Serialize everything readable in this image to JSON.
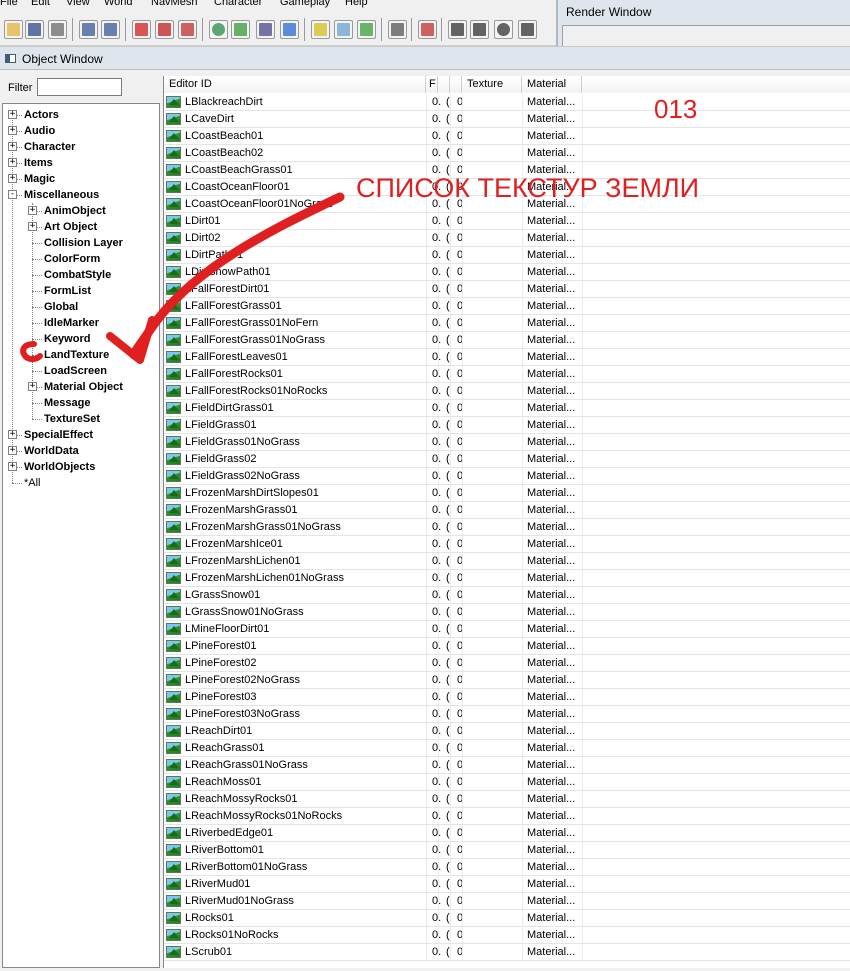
{
  "menu": [
    "File",
    "Edit",
    "View",
    "World",
    "NavMesh",
    "Character",
    "Gameplay",
    "Help"
  ],
  "toolbar_icons": [
    "open-icon",
    "save-icon",
    "preferences-icon",
    "undo-icon",
    "redo-icon",
    "render-region-icon",
    "marker-icon",
    "navmesh-icon",
    "world-icon",
    "landscape-icon",
    "havok-icon",
    "reference-icon",
    "light-bulb-icon",
    "sky-icon",
    "grass-icon",
    "speech-bubble-icon",
    "animation-icon",
    "box-icon",
    "box-m-icon",
    "box-o-icon",
    "box-d-icon",
    "box-c-icon"
  ],
  "render_window": {
    "title": "Render Window"
  },
  "object_window": {
    "title": "Object Window",
    "filter_label": "Filter",
    "filter_value": ""
  },
  "tree": [
    {
      "label": "Actors",
      "depth": 0,
      "expander": "+"
    },
    {
      "label": "Audio",
      "depth": 0,
      "expander": "+"
    },
    {
      "label": "Character",
      "depth": 0,
      "expander": "+"
    },
    {
      "label": "Items",
      "depth": 0,
      "expander": "+"
    },
    {
      "label": "Magic",
      "depth": 0,
      "expander": "+"
    },
    {
      "label": "Miscellaneous",
      "depth": 0,
      "expander": "-"
    },
    {
      "label": "AnimObject",
      "depth": 1,
      "expander": "+"
    },
    {
      "label": "Art Object",
      "depth": 1,
      "expander": "+"
    },
    {
      "label": "Collision Layer",
      "depth": 1,
      "expander": ""
    },
    {
      "label": "ColorForm",
      "depth": 1,
      "expander": ""
    },
    {
      "label": "CombatStyle",
      "depth": 1,
      "expander": ""
    },
    {
      "label": "FormList",
      "depth": 1,
      "expander": ""
    },
    {
      "label": "Global",
      "depth": 1,
      "expander": ""
    },
    {
      "label": "IdleMarker",
      "depth": 1,
      "expander": ""
    },
    {
      "label": "Keyword",
      "depth": 1,
      "expander": ""
    },
    {
      "label": "LandTexture",
      "depth": 1,
      "expander": ""
    },
    {
      "label": "LoadScreen",
      "depth": 1,
      "expander": ""
    },
    {
      "label": "Material Object",
      "depth": 1,
      "expander": "+"
    },
    {
      "label": "Message",
      "depth": 1,
      "expander": ""
    },
    {
      "label": "TextureSet",
      "depth": 1,
      "expander": ""
    },
    {
      "label": "SpecialEffect",
      "depth": 0,
      "expander": "+"
    },
    {
      "label": "WorldData",
      "depth": 0,
      "expander": "+"
    },
    {
      "label": "WorldObjects",
      "depth": 0,
      "expander": "+"
    },
    {
      "label": "*All",
      "depth": 0,
      "expander": "",
      "plain": true
    }
  ],
  "columns": [
    "Editor ID",
    "F",
    "",
    "",
    "Texture",
    "Material"
  ],
  "rows": [
    {
      "id": "LBlackreachDirt",
      "f": "0.",
      "a": "(",
      "b": "0",
      "mat": "Material..."
    },
    {
      "id": "LCaveDirt",
      "f": "0.",
      "a": "(",
      "b": "0",
      "mat": "Material..."
    },
    {
      "id": "LCoastBeach01",
      "f": "0.",
      "a": "(",
      "b": "0",
      "mat": "Material..."
    },
    {
      "id": "LCoastBeach02",
      "f": "0.",
      "a": "(",
      "b": "0",
      "mat": "Material..."
    },
    {
      "id": "LCoastBeachGrass01",
      "f": "0.",
      "a": "(",
      "b": "0",
      "mat": "Material..."
    },
    {
      "id": "LCoastOceanFloor01",
      "f": "0.",
      "a": "(",
      "b": "0",
      "mat": "Material..."
    },
    {
      "id": "LCoastOceanFloor01NoGrass",
      "f": "0.",
      "a": "(",
      "b": "0",
      "mat": "Material..."
    },
    {
      "id": "LDirt01",
      "f": "0.",
      "a": "(",
      "b": "0",
      "mat": "Material..."
    },
    {
      "id": "LDirt02",
      "f": "0.",
      "a": "(",
      "b": "0",
      "mat": "Material..."
    },
    {
      "id": "LDirtPath01",
      "f": "0.",
      "a": "(",
      "b": "0",
      "mat": "Material..."
    },
    {
      "id": "LDirtSnowPath01",
      "f": "0.",
      "a": "(",
      "b": "0",
      "mat": "Material..."
    },
    {
      "id": "LFallForestDirt01",
      "f": "0.",
      "a": "(",
      "b": "0",
      "mat": "Material..."
    },
    {
      "id": "LFallForestGrass01",
      "f": "0.",
      "a": "(",
      "b": "0",
      "mat": "Material..."
    },
    {
      "id": "LFallForestGrass01NoFern",
      "f": "0.",
      "a": "(",
      "b": "0",
      "mat": "Material..."
    },
    {
      "id": "LFallForestGrass01NoGrass",
      "f": "0.",
      "a": "(",
      "b": "0",
      "mat": "Material..."
    },
    {
      "id": "LFallForestLeaves01",
      "f": "0.",
      "a": "(",
      "b": "0",
      "mat": "Material..."
    },
    {
      "id": "LFallForestRocks01",
      "f": "0.",
      "a": "(",
      "b": "0",
      "mat": "Material..."
    },
    {
      "id": "LFallForestRocks01NoRocks",
      "f": "0.",
      "a": "(",
      "b": "0",
      "mat": "Material..."
    },
    {
      "id": "LFieldDirtGrass01",
      "f": "0.",
      "a": "(",
      "b": "0",
      "mat": "Material..."
    },
    {
      "id": "LFieldGrass01",
      "f": "0.",
      "a": "(",
      "b": "0",
      "mat": "Material..."
    },
    {
      "id": "LFieldGrass01NoGrass",
      "f": "0.",
      "a": "(",
      "b": "0",
      "mat": "Material..."
    },
    {
      "id": "LFieldGrass02",
      "f": "0.",
      "a": "(",
      "b": "0",
      "mat": "Material..."
    },
    {
      "id": "LFieldGrass02NoGrass",
      "f": "0.",
      "a": "(",
      "b": "0",
      "mat": "Material..."
    },
    {
      "id": "LFrozenMarshDirtSlopes01",
      "f": "0.",
      "a": "(",
      "b": "0",
      "mat": "Material..."
    },
    {
      "id": "LFrozenMarshGrass01",
      "f": "0.",
      "a": "(",
      "b": "0",
      "mat": "Material..."
    },
    {
      "id": "LFrozenMarshGrass01NoGrass",
      "f": "0.",
      "a": "(",
      "b": "0",
      "mat": "Material..."
    },
    {
      "id": "LFrozenMarshIce01",
      "f": "0.",
      "a": "(",
      "b": "0",
      "mat": "Material..."
    },
    {
      "id": "LFrozenMarshLichen01",
      "f": "0.",
      "a": "(",
      "b": "0",
      "mat": "Material..."
    },
    {
      "id": "LFrozenMarshLichen01NoGrass",
      "f": "0.",
      "a": "(",
      "b": "0",
      "mat": "Material..."
    },
    {
      "id": "LGrassSnow01",
      "f": "0.",
      "a": "(",
      "b": "0",
      "mat": "Material..."
    },
    {
      "id": "LGrassSnow01NoGrass",
      "f": "0.",
      "a": "(",
      "b": "0",
      "mat": "Material..."
    },
    {
      "id": "LMineFloorDirt01",
      "f": "0.",
      "a": "(",
      "b": "0",
      "mat": "Material..."
    },
    {
      "id": "LPineForest01",
      "f": "0.",
      "a": "(",
      "b": "0",
      "mat": "Material..."
    },
    {
      "id": "LPineForest02",
      "f": "0.",
      "a": "(",
      "b": "0",
      "mat": "Material..."
    },
    {
      "id": "LPineForest02NoGrass",
      "f": "0.",
      "a": "(",
      "b": "0",
      "mat": "Material..."
    },
    {
      "id": "LPineForest03",
      "f": "0.",
      "a": "(",
      "b": "0",
      "mat": "Material..."
    },
    {
      "id": "LPineForest03NoGrass",
      "f": "0.",
      "a": "(",
      "b": "0",
      "mat": "Material..."
    },
    {
      "id": "LReachDirt01",
      "f": "0.",
      "a": "(",
      "b": "0",
      "mat": "Material..."
    },
    {
      "id": "LReachGrass01",
      "f": "0.",
      "a": "(",
      "b": "0",
      "mat": "Material..."
    },
    {
      "id": "LReachGrass01NoGrass",
      "f": "0.",
      "a": "(",
      "b": "0",
      "mat": "Material..."
    },
    {
      "id": "LReachMoss01",
      "f": "0.",
      "a": "(",
      "b": "0",
      "mat": "Material..."
    },
    {
      "id": "LReachMossyRocks01",
      "f": "0.",
      "a": "(",
      "b": "0",
      "mat": "Material..."
    },
    {
      "id": "LReachMossyRocks01NoRocks",
      "f": "0.",
      "a": "(",
      "b": "0",
      "mat": "Material..."
    },
    {
      "id": "LRiverbedEdge01",
      "f": "0.",
      "a": "(",
      "b": "0",
      "mat": "Material..."
    },
    {
      "id": "LRiverBottom01",
      "f": "0.",
      "a": "(",
      "b": "0",
      "mat": "Material..."
    },
    {
      "id": "LRiverBottom01NoGrass",
      "f": "0.",
      "a": "(",
      "b": "0",
      "mat": "Material..."
    },
    {
      "id": "LRiverMud01",
      "f": "0.",
      "a": "(",
      "b": "0",
      "mat": "Material..."
    },
    {
      "id": "LRiverMud01NoGrass",
      "f": "0.",
      "a": "(",
      "b": "0",
      "mat": "Material..."
    },
    {
      "id": "LRocks01",
      "f": "0.",
      "a": "(",
      "b": "0",
      "mat": "Material..."
    },
    {
      "id": "LRocks01NoRocks",
      "f": "0.",
      "a": "(",
      "b": "0",
      "mat": "Material..."
    },
    {
      "id": "LScrub01",
      "f": "0.",
      "a": "(",
      "b": "0",
      "mat": "Material..."
    }
  ],
  "annotations": {
    "number": "013",
    "label": "СПИСОК ТЕКСТУР ЗЕМЛИ",
    "color": "#e02020"
  }
}
